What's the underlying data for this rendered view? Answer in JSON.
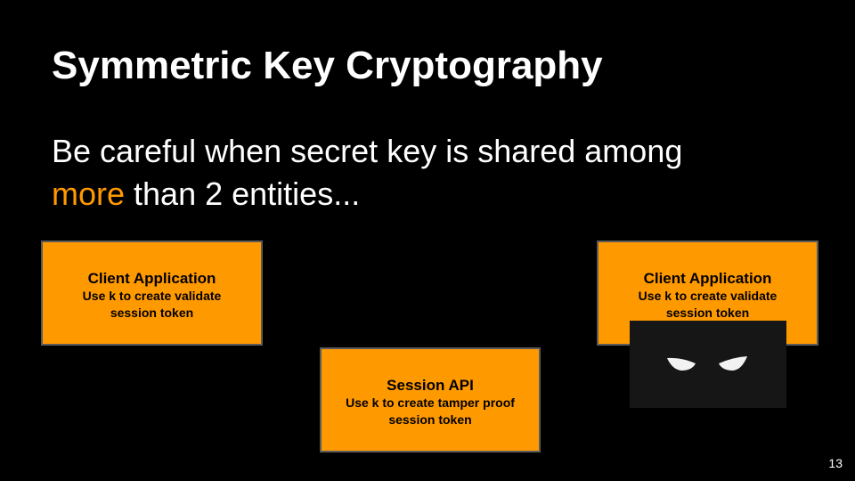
{
  "slide": {
    "title": "Symmetric Key Cryptography",
    "subtitle_line1": "Be careful when secret key is shared among",
    "subtitle_highlight": "more",
    "subtitle_line2_rest": " than 2 entities...",
    "page_number": "13"
  },
  "boxes": {
    "left": {
      "title": "Client Application",
      "description": "Use k to create validate\nsession token"
    },
    "middle": {
      "title": "Session API",
      "description": "Use k to create tamper proof\nsession token"
    },
    "right": {
      "title": "Client Application",
      "description": "Use k to create validate\nsession token"
    }
  },
  "colors": {
    "background": "#000000",
    "accent": "#ff9900",
    "box_border": "#5b5b5b",
    "text": "#ffffff"
  },
  "icons": {
    "intruder": "masked-eyes-icon"
  }
}
